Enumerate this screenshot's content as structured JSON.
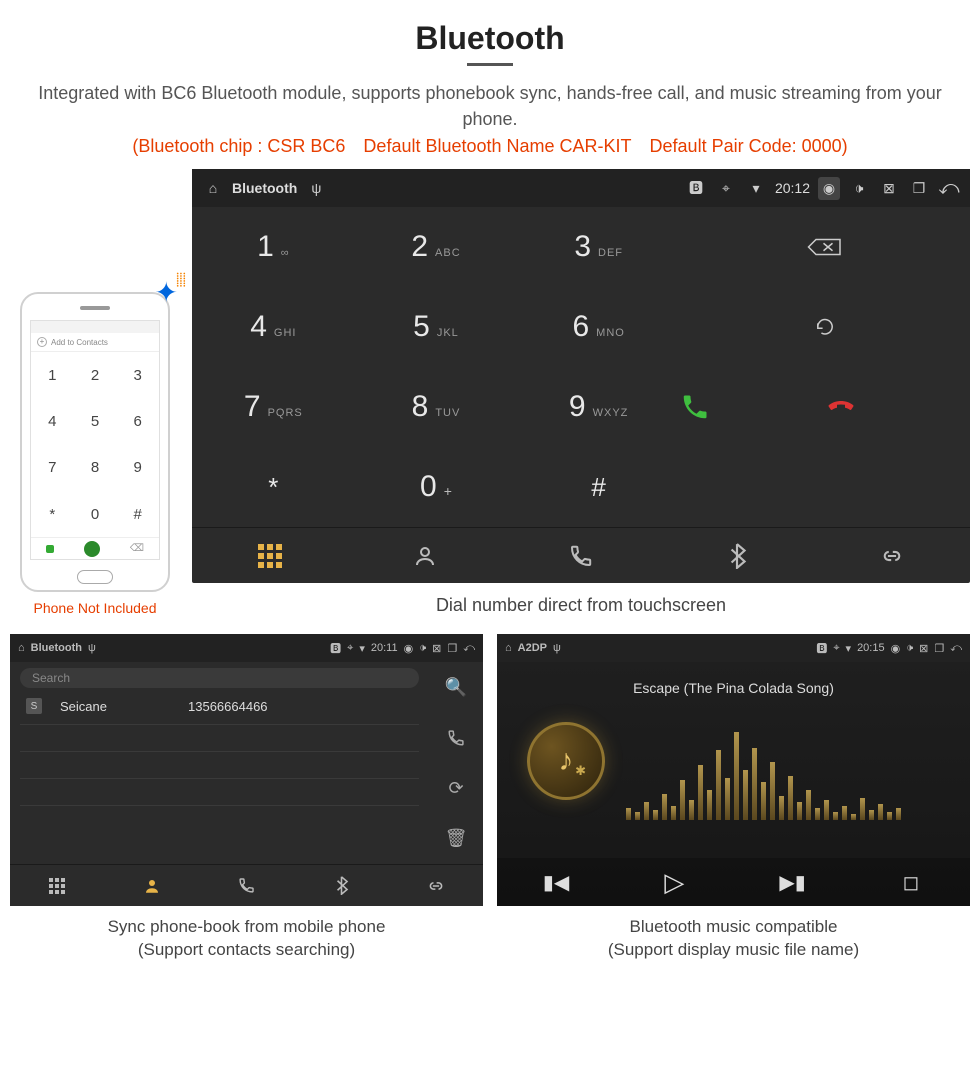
{
  "header": {
    "title": "Bluetooth",
    "desc": "Integrated with BC6 Bluetooth module, supports phonebook sync, hands-free call, and music streaming from your phone.",
    "spec": "(Bluetooth chip : CSR BC6 Default Bluetooth Name CAR-KIT Default Pair Code: 0000)"
  },
  "phone": {
    "add_label": "Add to Contacts",
    "keys": [
      "1",
      "2",
      "3",
      "4",
      "5",
      "6",
      "7",
      "8",
      "9",
      "*",
      "0",
      "#"
    ],
    "caption": "Phone Not Included"
  },
  "dialer": {
    "bar": {
      "title": "Bluetooth",
      "time": "20:12"
    },
    "keys": [
      {
        "n": "1",
        "l": "∞"
      },
      {
        "n": "2",
        "l": "ABC"
      },
      {
        "n": "3",
        "l": "DEF"
      },
      {
        "n": "4",
        "l": "GHI"
      },
      {
        "n": "5",
        "l": "JKL"
      },
      {
        "n": "6",
        "l": "MNO"
      },
      {
        "n": "7",
        "l": "PQRS"
      },
      {
        "n": "8",
        "l": "TUV"
      },
      {
        "n": "9",
        "l": "WXYZ"
      },
      {
        "n": "*",
        "l": ""
      },
      {
        "n": "0",
        "l": "",
        "sup": "+"
      },
      {
        "n": "#",
        "l": ""
      }
    ],
    "caption": "Dial number direct from touchscreen"
  },
  "contacts": {
    "bar": {
      "title": "Bluetooth",
      "time": "20:11"
    },
    "search_placeholder": "Search",
    "row": {
      "initial": "S",
      "name": "Seicane",
      "number": "13566664466"
    },
    "caption_l1": "Sync phone-book from mobile phone",
    "caption_l2": "(Support contacts searching)"
  },
  "music": {
    "bar": {
      "title": "A2DP",
      "time": "20:15"
    },
    "song": "Escape (The Pina Colada Song)",
    "viz_heights": [
      12,
      8,
      18,
      10,
      26,
      14,
      40,
      20,
      55,
      30,
      70,
      42,
      88,
      50,
      72,
      38,
      58,
      24,
      44,
      18,
      30,
      12,
      20,
      8,
      14,
      6,
      22,
      10,
      16,
      8,
      12
    ],
    "caption_l1": "Bluetooth music compatible",
    "caption_l2": "(Support display music file name)"
  }
}
